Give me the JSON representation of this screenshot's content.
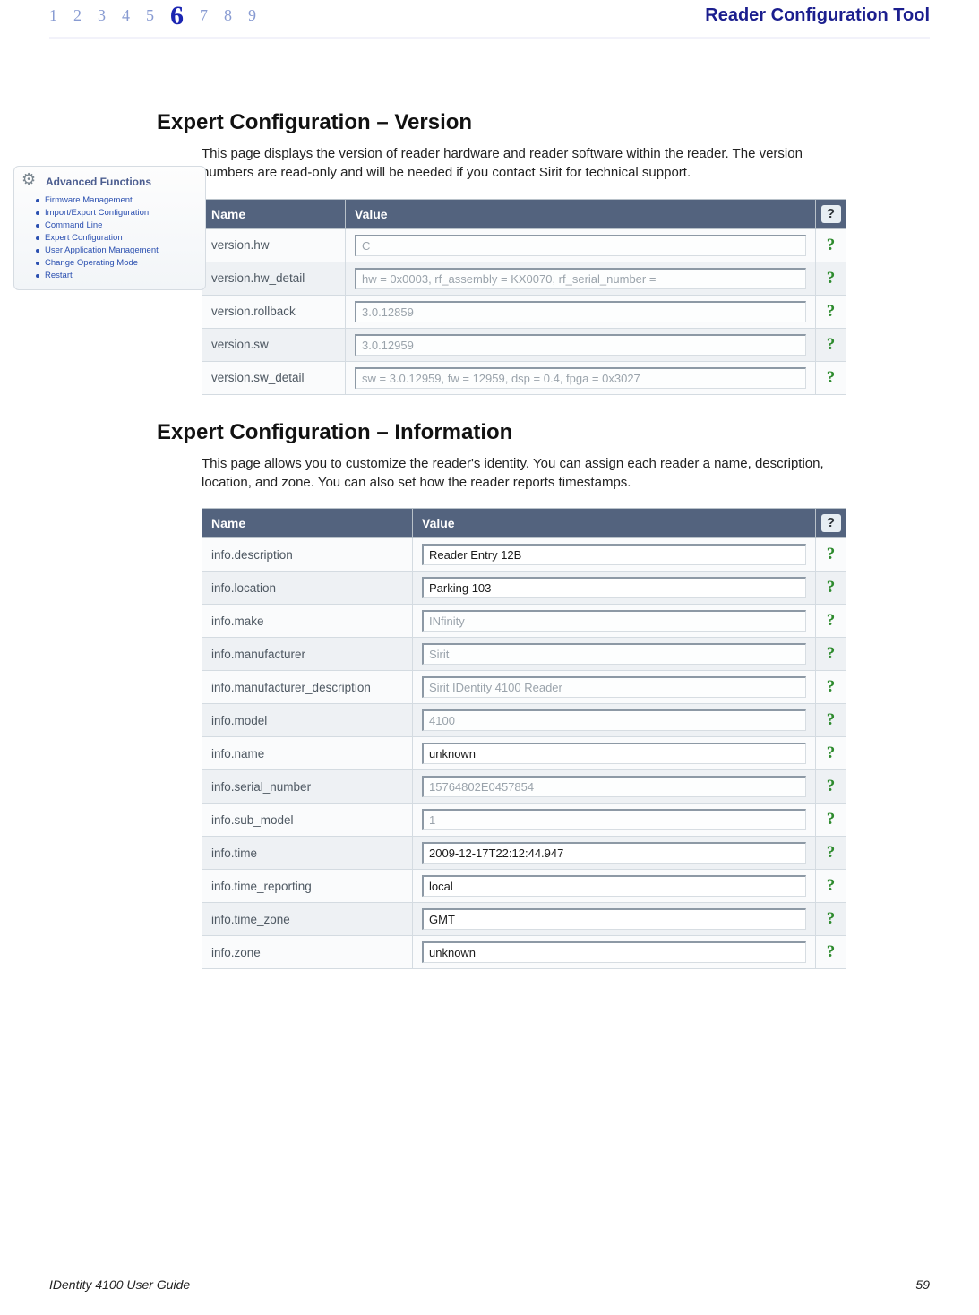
{
  "header": {
    "chapters": [
      "1",
      "2",
      "3",
      "4",
      "5",
      "6",
      "7",
      "8",
      "9"
    ],
    "current_index": 5,
    "title": "Reader Configuration Tool"
  },
  "sidebar": {
    "title": "Advanced Functions",
    "items": [
      "Firmware Management",
      "Import/Export Configuration",
      "Command Line",
      "Expert Configuration",
      "User Application Management",
      "Change Operating Mode",
      "Restart"
    ]
  },
  "section1": {
    "heading": "Expert Configuration – Version",
    "text": "This page displays the version of reader hardware and reader software within the reader. The version numbers are read-only and will be needed if you contact Sirit for technical support.",
    "table": {
      "name_header": "Name",
      "value_header": "Value",
      "help_header": "?",
      "rows": [
        {
          "name": "version.hw",
          "value": "C",
          "readonly": true
        },
        {
          "name": "version.hw_detail",
          "value": "hw = 0x0003, rf_assembly = KX0070, rf_serial_number =",
          "readonly": true
        },
        {
          "name": "version.rollback",
          "value": "3.0.12859",
          "readonly": true
        },
        {
          "name": "version.sw",
          "value": "3.0.12959",
          "readonly": true
        },
        {
          "name": "version.sw_detail",
          "value": "sw = 3.0.12959, fw = 12959, dsp = 0.4, fpga = 0x3027",
          "readonly": true
        }
      ]
    }
  },
  "section2": {
    "heading": "Expert Configuration – Information",
    "text": "This page allows you to customize the reader's identity. You can assign each reader a name, description, location, and zone. You can also set how the reader reports timestamps.",
    "table": {
      "name_header": "Name",
      "value_header": "Value",
      "help_header": "?",
      "rows": [
        {
          "name": "info.description",
          "value": "Reader Entry 12B",
          "readonly": false
        },
        {
          "name": "info.location",
          "value": "Parking 103",
          "readonly": false
        },
        {
          "name": "info.make",
          "value": "INfinity",
          "readonly": true
        },
        {
          "name": "info.manufacturer",
          "value": "Sirit",
          "readonly": true
        },
        {
          "name": "info.manufacturer_description",
          "value": "Sirit IDentity 4100 Reader",
          "readonly": true
        },
        {
          "name": "info.model",
          "value": "4100",
          "readonly": true
        },
        {
          "name": "info.name",
          "value": "unknown",
          "readonly": false
        },
        {
          "name": "info.serial_number",
          "value": "15764802E0457854",
          "readonly": true
        },
        {
          "name": "info.sub_model",
          "value": "1",
          "readonly": true
        },
        {
          "name": "info.time",
          "value": "2009-12-17T22:12:44.947",
          "readonly": false
        },
        {
          "name": "info.time_reporting",
          "value": "local",
          "readonly": false
        },
        {
          "name": "info.time_zone",
          "value": "GMT",
          "readonly": false
        },
        {
          "name": "info.zone",
          "value": "unknown",
          "readonly": false
        }
      ]
    }
  },
  "footer": {
    "left": "IDentity 4100 User Guide",
    "right": "59"
  },
  "help_glyph": "?"
}
